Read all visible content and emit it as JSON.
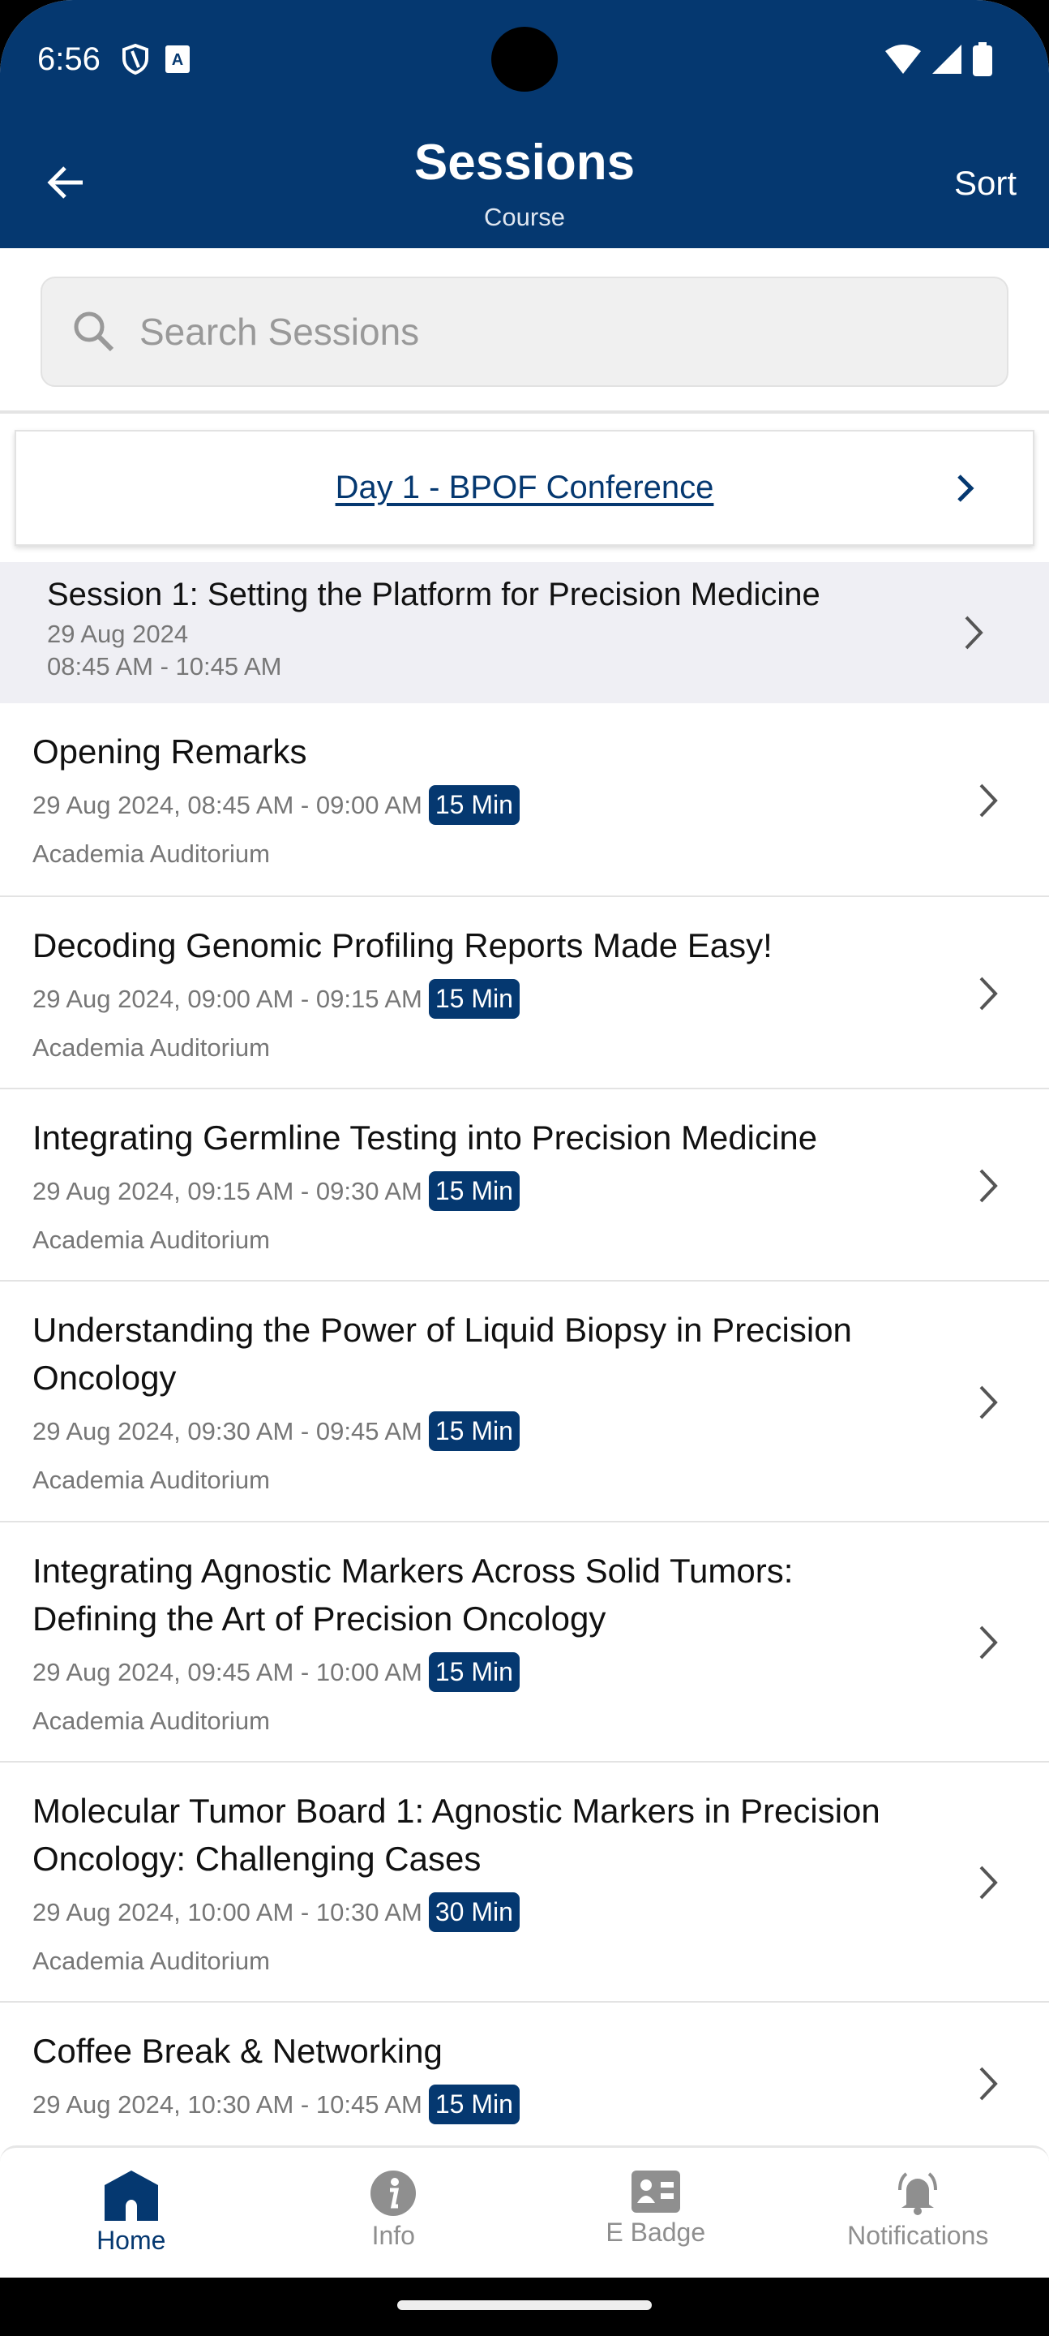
{
  "status_bar": {
    "time": "6:56"
  },
  "header": {
    "title": "Sessions",
    "subtitle": "Course",
    "sort_label": "Sort"
  },
  "search": {
    "placeholder": "Search Sessions",
    "value": ""
  },
  "day_selector": {
    "label": "Day 1 - BPOF Conference"
  },
  "session_group": {
    "title": "Session 1: Setting the Platform for Precision Medicine",
    "date": "29 Aug 2024",
    "time": "08:45 AM - 10:45 AM"
  },
  "items": [
    {
      "title": "Opening Remarks",
      "datetime": "29 Aug 2024, 08:45 AM - 09:00 AM",
      "duration": "15 Min",
      "location": "Academia Auditorium"
    },
    {
      "title": "Decoding Genomic Profiling Reports Made Easy!",
      "datetime": "29 Aug 2024, 09:00 AM - 09:15 AM",
      "duration": "15 Min",
      "location": "Academia Auditorium"
    },
    {
      "title": "Integrating Germline Testing into Precision Medicine",
      "datetime": "29 Aug 2024, 09:15 AM - 09:30 AM",
      "duration": "15 Min",
      "location": "Academia Auditorium"
    },
    {
      "title": "Understanding the Power of Liquid Biopsy in Precision Oncology",
      "datetime": "29 Aug 2024, 09:30 AM - 09:45 AM",
      "duration": "15 Min",
      "location": "Academia Auditorium"
    },
    {
      "title": "Integrating Agnostic Markers Across Solid Tumors: Defining the Art of Precision Oncology",
      "datetime": "29 Aug 2024, 09:45 AM - 10:00 AM",
      "duration": "15 Min",
      "location": "Academia Auditorium"
    },
    {
      "title": "Molecular Tumor Board 1: Agnostic Markers in Precision Oncology: Challenging Cases",
      "datetime": "29 Aug 2024, 10:00 AM - 10:30 AM",
      "duration": "30 Min",
      "location": "Academia Auditorium"
    },
    {
      "title": "Coffee Break & Networking",
      "datetime": "29 Aug 2024, 10:30 AM - 10:45 AM",
      "duration": "15 Min",
      "location": ""
    }
  ],
  "bottom_nav": [
    {
      "label": "Home",
      "icon": "home-icon",
      "active": true
    },
    {
      "label": "Info",
      "icon": "info-icon"
    },
    {
      "label": "E Badge",
      "icon": "badge-icon"
    },
    {
      "label": "Notifications",
      "icon": "bell-icon"
    }
  ],
  "colors": {
    "primary": "#053870",
    "muted": "#8f8f8f"
  }
}
